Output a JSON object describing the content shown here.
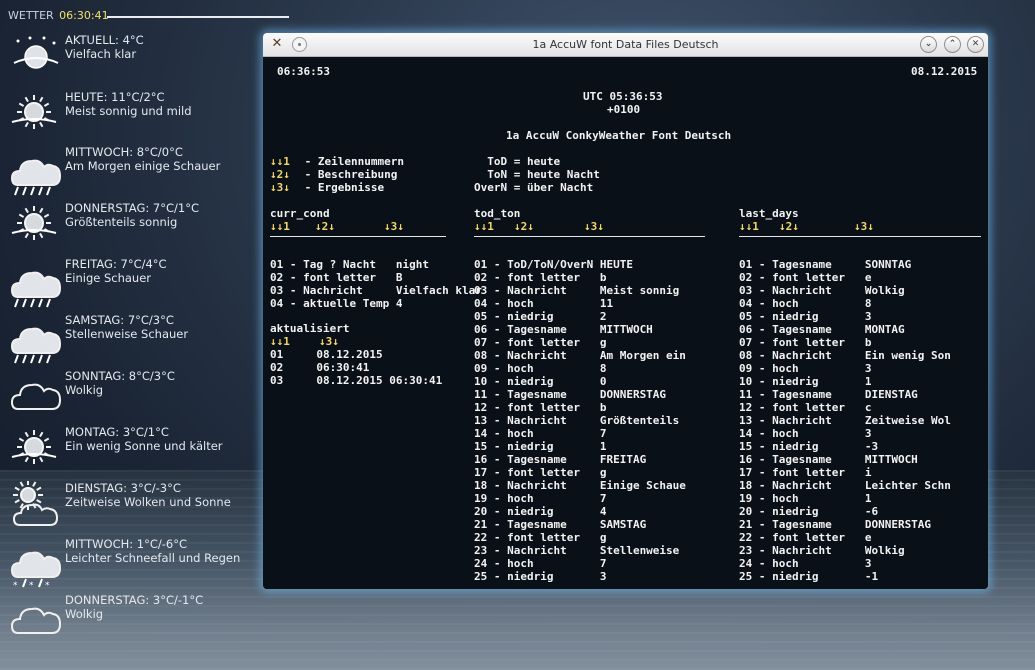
{
  "conky": {
    "header_label": "WETTER",
    "header_time": "06:30:41",
    "items": [
      {
        "title": "AKTUELL: 4°C",
        "desc": "Vielfach klar",
        "icon": "night-clear-icon"
      },
      {
        "title": "HEUTE: 11°C/2°C",
        "desc": "Meist sonnig und mild",
        "icon": "sun-icon"
      },
      {
        "title": "MITTWOCH: 8°C/0°C",
        "desc": "Am Morgen einige Schauer",
        "icon": "rain-cloud-icon"
      },
      {
        "title": "DONNERSTAG: 7°C/1°C",
        "desc": "Größtenteils sonnig",
        "icon": "sun-icon"
      },
      {
        "title": "FREITAG: 7°C/4°C",
        "desc": "Einige Schauer",
        "icon": "rain-cloud-icon"
      },
      {
        "title": "SAMSTAG: 7°C/3°C",
        "desc": "Stellenweise Schauer",
        "icon": "rain-cloud-icon"
      },
      {
        "title": "SONNTAG: 8°C/3°C",
        "desc": "Wolkig",
        "icon": "cloud-icon"
      },
      {
        "title": "MONTAG: 3°C/1°C",
        "desc": "Ein wenig Sonne und kälter",
        "icon": "sun-icon"
      },
      {
        "title": "DIENSTAG: 3°C/-3°C",
        "desc": "Zeitweise Wolken und Sonne",
        "icon": "sun-cloud-icon"
      },
      {
        "title": "MITTWOCH: 1°C/-6°C",
        "desc": "Leichter Schneefall und Regen",
        "icon": "snow-rain-icon"
      },
      {
        "title": "DONNERSTAG: 3°C/-1°C",
        "desc": "Wolkig",
        "icon": "cloud-icon"
      }
    ]
  },
  "window": {
    "title": "1a AccuW font Data Files Deutsch",
    "close_glyph": "✕",
    "max_glyph": "⌃",
    "min_glyph": "⌄"
  },
  "terminal": {
    "time_local": "06:36:53",
    "date": "08.12.2015",
    "utc": "UTC 05:36:53",
    "offset": "+0100",
    "heading": "1a AccuW ConkyWeather Font Deutsch",
    "legend": [
      {
        "mark": "↓↓1",
        "text": " - Zeilennummern"
      },
      {
        "mark": "↓2↓",
        "text": " - Beschreibung"
      },
      {
        "mark": "↓3↓",
        "text": " - Ergebnisse"
      }
    ],
    "legend2": [
      "  ToD = heute",
      "  ToN = heute Nacht",
      "OverN = über Nacht"
    ],
    "sections": {
      "curr_cond": {
        "title": "curr_cond",
        "cols": [
          "↓↓1",
          "↓2↓",
          "↓3↓"
        ],
        "lines": [
          "01 - Tag ? Nacht   night",
          "02 - font letter   B",
          "03 - Nachricht     Vielfach klar",
          "04 - aktuelle Temp 4"
        ]
      },
      "aktualisiert": {
        "title": "aktualisiert",
        "cols": [
          "↓↓1",
          "↓3↓"
        ],
        "lines": [
          "01     08.12.2015",
          "02     06:30:41",
          "03     08.12.2015 06:30:41"
        ]
      },
      "tod_ton": {
        "title": "tod_ton",
        "cols": [
          "↓↓1",
          "↓2↓",
          "↓3↓"
        ],
        "lines": [
          "01 - ToD/ToN/OverN HEUTE",
          "02 - font letter   b",
          "03 - Nachricht     Meist sonnig",
          "04 - hoch          11",
          "05 - niedrig       2",
          "06 - Tagesname     MITTWOCH",
          "07 - font letter   g",
          "08 - Nachricht     Am Morgen ein",
          "09 - hoch          8",
          "10 - niedrig       0",
          "11 - Tagesname     DONNERSTAG",
          "12 - font letter   b",
          "13 - Nachricht     Größtenteils",
          "14 - hoch          7",
          "15 - niedrig       1",
          "16 - Tagesname     FREITAG",
          "17 - font letter   g",
          "18 - Nachricht     Einige Schaue",
          "19 - hoch          7",
          "20 - niedrig       4",
          "21 - Tagesname     SAMSTAG",
          "22 - font letter   g",
          "23 - Nachricht     Stellenweise",
          "24 - hoch          7",
          "25 - niedrig       3"
        ]
      },
      "last_days": {
        "title": "last_days",
        "cols": [
          "↓↓1",
          "↓2↓",
          "↓3↓"
        ],
        "lines": [
          "01 - Tagesname     SONNTAG",
          "02 - font letter   e",
          "03 - Nachricht     Wolkig",
          "04 - hoch          8",
          "05 - niedrig       3",
          "06 - Tagesname     MONTAG",
          "07 - font letter   b",
          "08 - Nachricht     Ein wenig Son",
          "09 - hoch          3",
          "10 - niedrig       1",
          "11 - Tagesname     DIENSTAG",
          "12 - font letter   c",
          "13 - Nachricht     Zeitweise Wol",
          "14 - hoch          3",
          "15 - niedrig       -3",
          "16 - Tagesname     MITTWOCH",
          "17 - font letter   i",
          "18 - Nachricht     Leichter Schn",
          "19 - hoch          1",
          "20 - niedrig       -6",
          "21 - Tagesname     DONNERSTAG",
          "22 - font letter   e",
          "23 - Nachricht     Wolkig",
          "24 - hoch          3",
          "25 - niedrig       -1"
        ]
      }
    }
  }
}
